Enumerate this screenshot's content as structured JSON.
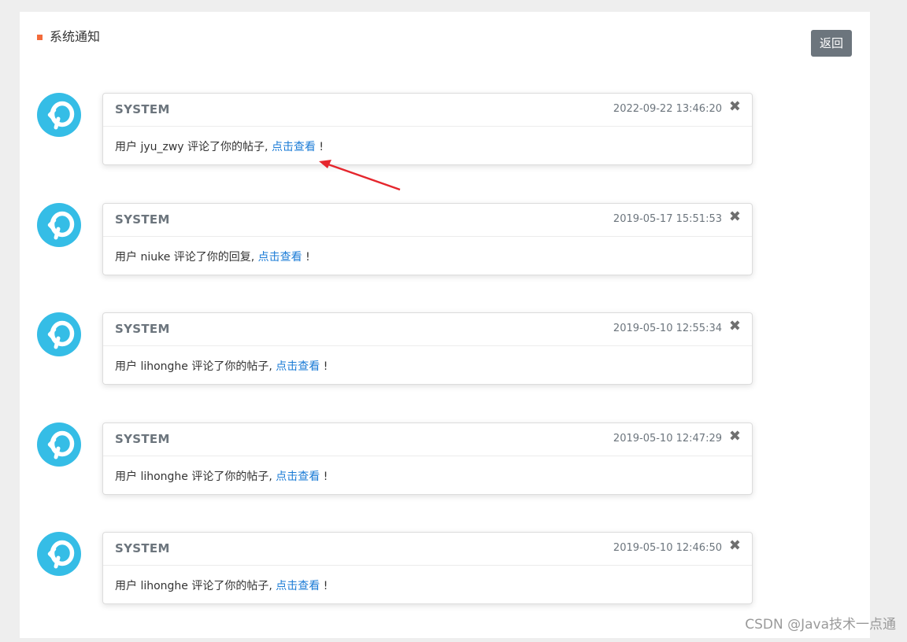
{
  "header": {
    "title": "系统通知",
    "back_label": "返回"
  },
  "notices": [
    {
      "sender": "SYSTEM",
      "time": "2022-09-22 13:46:20",
      "close": "✖",
      "prefix": "用户 jyu_zwy 评论了你的帖子, ",
      "link": "点击查看",
      "suffix": " !"
    },
    {
      "sender": "SYSTEM",
      "time": "2019-05-17 15:51:53",
      "close": "✖",
      "prefix": "用户 niuke 评论了你的回复, ",
      "link": "点击查看",
      "suffix": " !"
    },
    {
      "sender": "SYSTEM",
      "time": "2019-05-10 12:55:34",
      "close": "✖",
      "prefix": "用户 lihonghe 评论了你的帖子, ",
      "link": "点击查看",
      "suffix": " !"
    },
    {
      "sender": "SYSTEM",
      "time": "2019-05-10 12:47:29",
      "close": "✖",
      "prefix": "用户 lihonghe 评论了你的帖子, ",
      "link": "点击查看",
      "suffix": " !"
    },
    {
      "sender": "SYSTEM",
      "time": "2019-05-10 12:46:50",
      "close": "✖",
      "prefix": "用户 lihonghe 评论了你的帖子, ",
      "link": "点击查看",
      "suffix": " !"
    }
  ],
  "watermark": "CSDN @Java技术一点通",
  "colors": {
    "accent_marker": "#f36b3b",
    "avatar_bg": "#35bde6",
    "link": "#1a7bd6",
    "back_button": "#6c757d",
    "annotation_arrow": "#e5262d"
  },
  "icons": {
    "avatar": "system-logo-icon",
    "close": "close-icon",
    "annotation": "red-arrow-icon"
  }
}
